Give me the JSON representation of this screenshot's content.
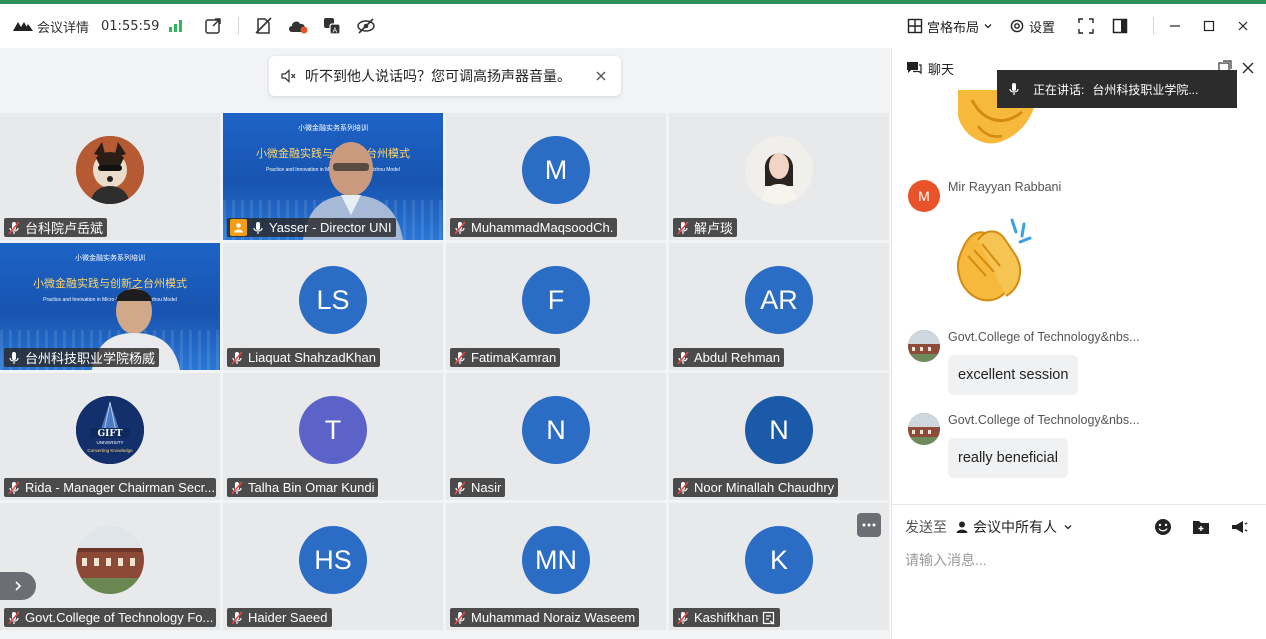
{
  "topbar": {
    "meeting_title": "会议详情",
    "timer": "01:55:59",
    "layout_label": "宫格布局",
    "settings_label": "设置",
    "accent": "#2f8f5b"
  },
  "notice": {
    "message": "听不到他人说话吗？您可调高扬声器音量。"
  },
  "participants": [
    {
      "name": "台科院卢岳斌",
      "initials": "",
      "color": "",
      "kind": "photo-dog",
      "mic": "muted"
    },
    {
      "name": "Yasser - Director UNI",
      "initials": "",
      "color": "",
      "kind": "video-yasser",
      "mic": "on",
      "host": true
    },
    {
      "name": "MuhammadMaqsoodCh.",
      "initials": "M",
      "color": "#2b6cc4",
      "kind": "initials",
      "mic": "muted"
    },
    {
      "name": "解卢琰",
      "initials": "",
      "color": "",
      "kind": "photo-woman",
      "mic": "muted"
    },
    {
      "name": "台州科技职业学院杨威",
      "initials": "",
      "color": "",
      "kind": "video-yang",
      "mic": "on",
      "active": true
    },
    {
      "name": "Liaquat ShahzadKhan",
      "initials": "LS",
      "color": "#2b6cc4",
      "kind": "initials",
      "mic": "muted"
    },
    {
      "name": "FatimaKamran",
      "initials": "F",
      "color": "#2b6cc4",
      "kind": "initials",
      "mic": "muted"
    },
    {
      "name": "Abdul Rehman",
      "initials": "AR",
      "color": "#2b6cc4",
      "kind": "initials",
      "mic": "muted"
    },
    {
      "name": "Rida - Manager Chairman Secr...",
      "initials": "",
      "color": "",
      "kind": "logo-gift",
      "mic": "muted"
    },
    {
      "name": "Talha Bin Omar Kundi",
      "initials": "T",
      "color": "#5b63c9",
      "kind": "initials",
      "mic": "muted"
    },
    {
      "name": "Nasir",
      "initials": "N",
      "color": "#2b6cc4",
      "kind": "initials",
      "mic": "muted"
    },
    {
      "name": "Noor Minallah Chaudhry",
      "initials": "N",
      "color": "#1b5aa8",
      "kind": "initials",
      "mic": "muted"
    },
    {
      "name": "Govt.College of Technology Fo...",
      "initials": "",
      "color": "",
      "kind": "photo-building",
      "mic": "muted"
    },
    {
      "name": "Haider Saeed",
      "initials": "HS",
      "color": "#2b6cc4",
      "kind": "initials",
      "mic": "muted"
    },
    {
      "name": "Muhammad Noraiz Waseem",
      "initials": "MN",
      "color": "#2b6cc4",
      "kind": "initials",
      "mic": "muted"
    },
    {
      "name": "Kashifkhan",
      "initials": "K",
      "color": "#2b6cc4",
      "kind": "initials",
      "mic": "muted"
    }
  ],
  "video_slide": {
    "header": "小微金融实务系列培训",
    "title": "小微金融实践与创新之台州模式",
    "subtitle": "Practice and Innovation in Micro-finance: The Taizhou Model"
  },
  "chat": {
    "title": "聊天",
    "speaking_label": "正在讲话:",
    "speaking_name": "台州科技职业学院...",
    "messages": [
      {
        "sender": "Mir Rayyan Rabbani",
        "avatar_initial": "M",
        "avatar_color": "#e8532a",
        "content": "clap-emoji"
      },
      {
        "sender": "Govt.College of Technology&nbs...",
        "avatar_initial": "",
        "avatar_color": "",
        "content": "excellent session"
      },
      {
        "sender": "Govt.College of Technology&nbs...",
        "avatar_initial": "",
        "avatar_color": "",
        "content": "really beneficial"
      }
    ],
    "send_to_label": "发送至",
    "send_to_value": "会议中所有人",
    "input_placeholder": "请输入消息..."
  }
}
